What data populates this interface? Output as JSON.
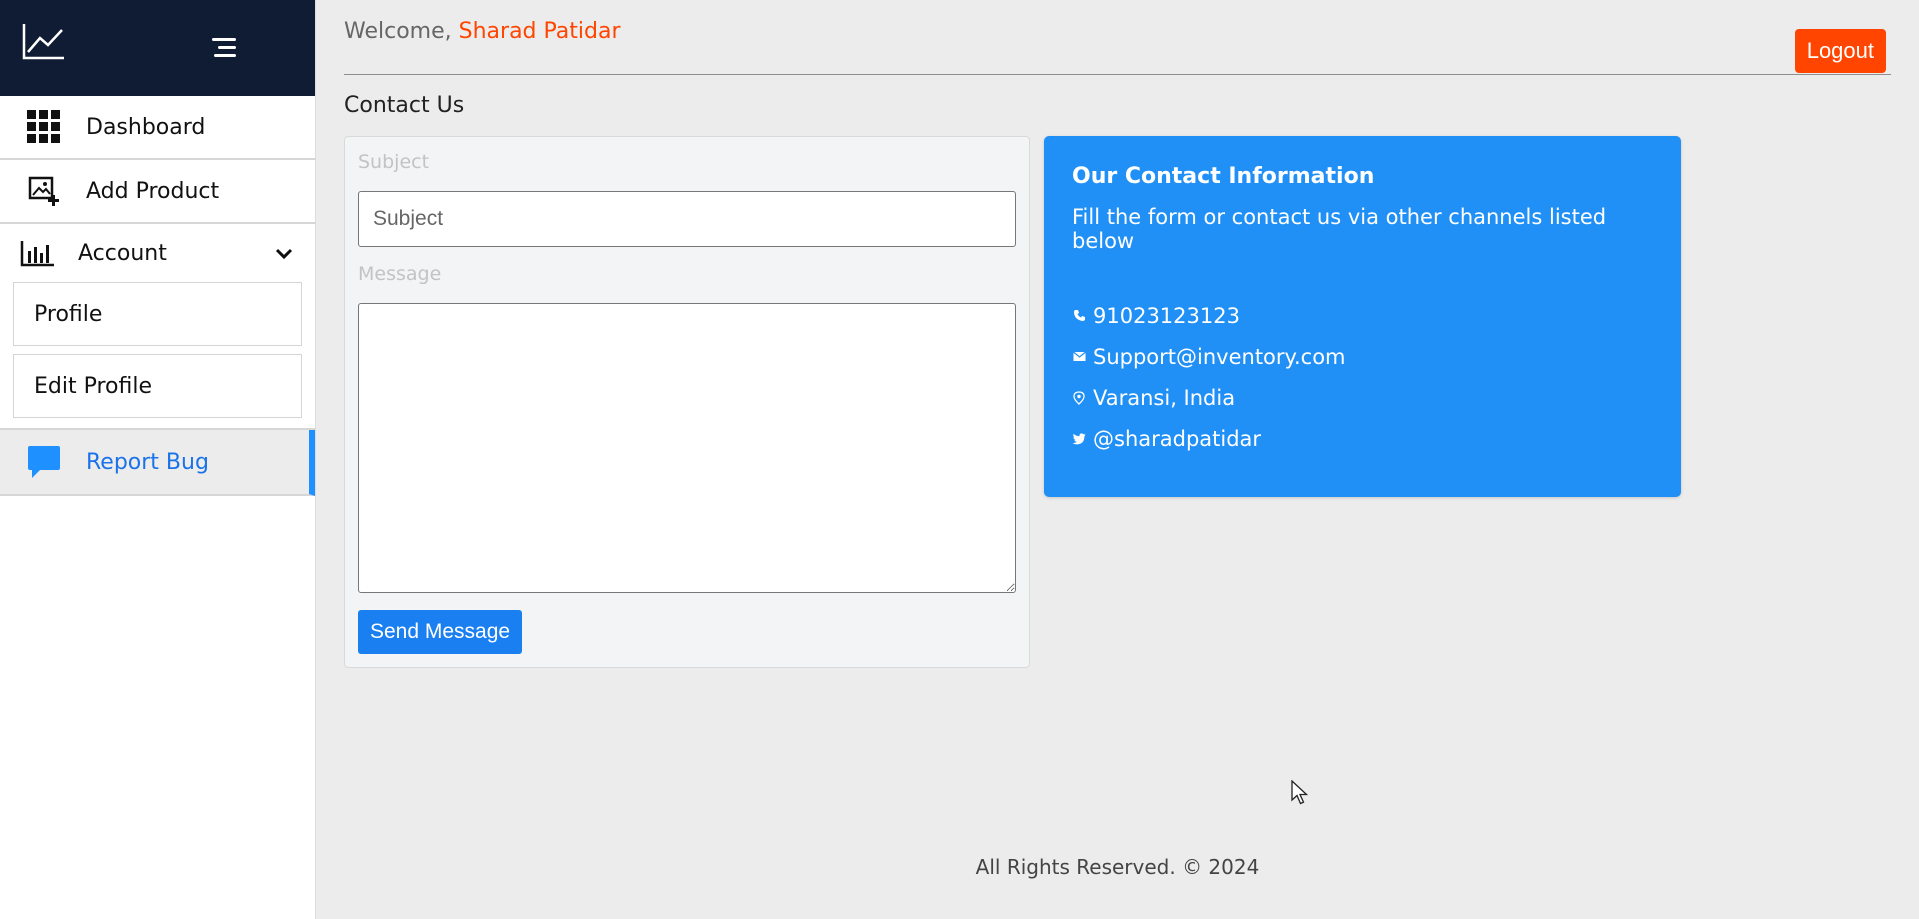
{
  "sidebar": {
    "logo_icon": "line-chart-icon",
    "toggle_icon": "menu-icon",
    "items": [
      {
        "label": "Dashboard",
        "icon": "grid-icon"
      },
      {
        "label": "Add Product",
        "icon": "add-image-icon"
      },
      {
        "label": "Account",
        "icon": "bar-chart-icon"
      },
      {
        "label": "Report Bug",
        "icon": "chat-bubble-icon"
      }
    ],
    "account_sub": [
      "Profile",
      "Edit Profile"
    ],
    "active_color": "#1e90ff",
    "header_color": "#101c33"
  },
  "header": {
    "welcome": "Welcome,",
    "user_name": "Sharad Patidar",
    "logout_label": "Logout"
  },
  "page": {
    "title": "Contact Us"
  },
  "form": {
    "subject_label": "Subject",
    "subject_placeholder": "Subject",
    "message_label": "Message",
    "send_label": "Send Message"
  },
  "contact": {
    "title": "Our Contact Information",
    "subtitle": "Fill the form or contact us via other channels listed below",
    "phone": "91023123123",
    "email": "Support@inventory.com",
    "location": "Varansi, India",
    "twitter": "@sharadpatidar",
    "card_color": "#2190f6"
  },
  "footer": {
    "text": "All Rights Reserved. © 2024"
  },
  "colors": {
    "accent": "#ff4500",
    "primary": "#1a7ff0"
  }
}
